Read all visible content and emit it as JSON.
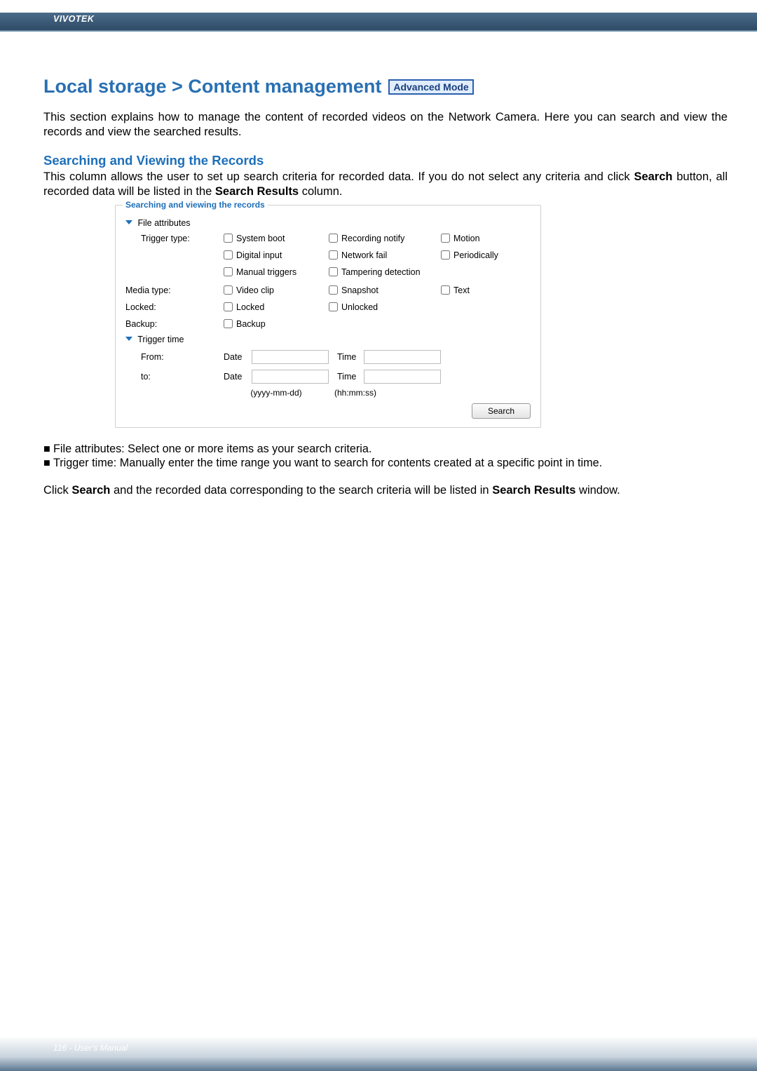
{
  "header": {
    "brand": "VIVOTEK"
  },
  "title": {
    "text": "Local storage > Content management",
    "mode_badge": "Advanced Mode"
  },
  "intro": "This section explains how to manage the content of recorded videos on the Network Camera. Here you can search and view the records and view the searched results.",
  "searching": {
    "subhead": "Searching and Viewing the Records",
    "desc_1": "This column allows the user to set up search criteria for recorded data. If you do not select any criteria and click ",
    "desc_bold_1": "Search",
    "desc_2": " button, all recorded data will be listed in the ",
    "desc_bold_2": "Search Results",
    "desc_3": " column."
  },
  "panel": {
    "legend": "Searching and viewing the records",
    "file_attr_head": "File attributes",
    "trigger_type_label": "Trigger type:",
    "system_boot": "System boot",
    "recording_notify": "Recording notify",
    "motion": "Motion",
    "digital_input": "Digital input",
    "network_fail": "Network fail",
    "periodically": "Periodically",
    "manual_triggers": "Manual triggers",
    "tampering_detection": "Tampering detection",
    "media_type_label": "Media type:",
    "video_clip": "Video clip",
    "snapshot": "Snapshot",
    "text": "Text",
    "locked_label": "Locked:",
    "locked": "Locked",
    "unlocked": "Unlocked",
    "backup_label": "Backup:",
    "backup": "Backup",
    "trigger_time_head": "Trigger time",
    "from_label": "From:",
    "to_label": "to:",
    "date_label": "Date",
    "time_label": "Time",
    "date_hint": "(yyyy-mm-dd)",
    "time_hint": "(hh:mm:ss)",
    "search_btn": "Search"
  },
  "bullets": {
    "b1": "File attributes: Select one or more items as your search criteria.",
    "b2": "Trigger time: Manually enter the time range you want to search for contents created at a specific point in time."
  },
  "after": {
    "p1a": "Click ",
    "p1b": "Search",
    "p1c": " and the recorded data corresponding to the search criteria will be listed in ",
    "p1d": "Search Results",
    "p1e": " window."
  },
  "footer": {
    "text": "116 - User's Manual"
  },
  "glyph": {
    "chev": "❤"
  }
}
